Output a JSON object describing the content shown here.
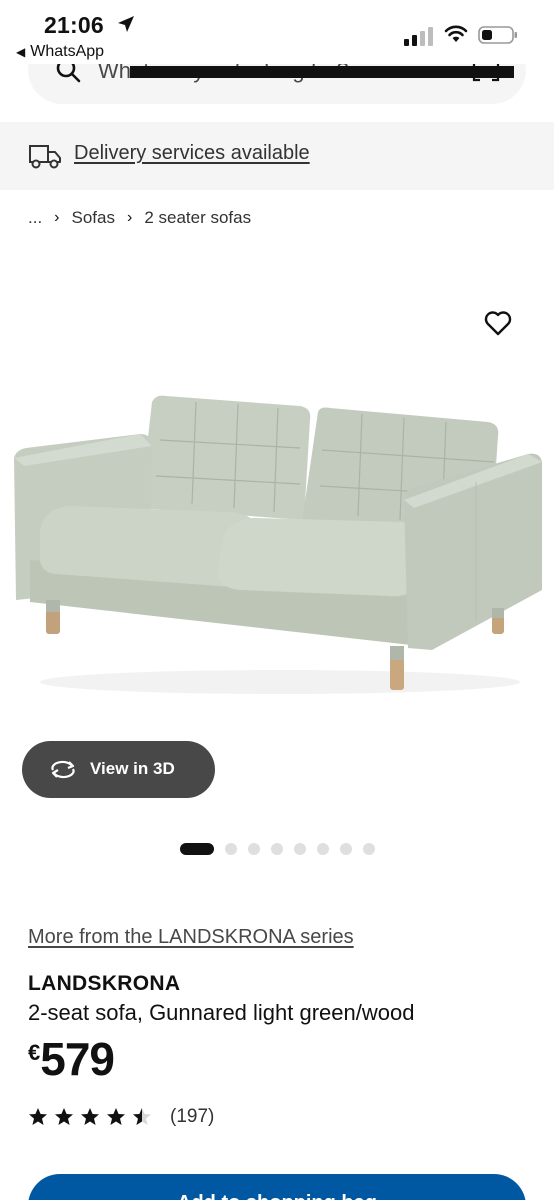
{
  "status_bar": {
    "time": "21:06",
    "back_app": "WhatsApp"
  },
  "search": {
    "placeholder": "What are you looking for?"
  },
  "delivery": {
    "label": "Delivery services available"
  },
  "breadcrumb": {
    "ellipsis": "...",
    "items": [
      "Sofas",
      "2 seater sofas"
    ]
  },
  "gallery": {
    "view3d_label": "View in 3D",
    "total_images": 8,
    "active_index": 0
  },
  "product": {
    "series_link": "More from the LANDSKRONA series",
    "name": "LANDSKRONA",
    "description": "2-seat sofa, Gunnared light green/wood",
    "currency": "€",
    "price": "579",
    "rating": 4.5,
    "review_count": "(197)"
  },
  "cta": {
    "add_label": "Add to shopping bag"
  },
  "colors": {
    "accent": "#0058a3",
    "sofa": "#c9d1c4",
    "dark_button": "#484848"
  },
  "icons": [
    "location-arrow-icon",
    "signal-icon",
    "wifi-icon",
    "battery-icon",
    "search-icon",
    "barcode-scan-icon",
    "truck-icon",
    "chevron-right-icon",
    "heart-icon",
    "rotate-3d-icon",
    "star-icon"
  ]
}
